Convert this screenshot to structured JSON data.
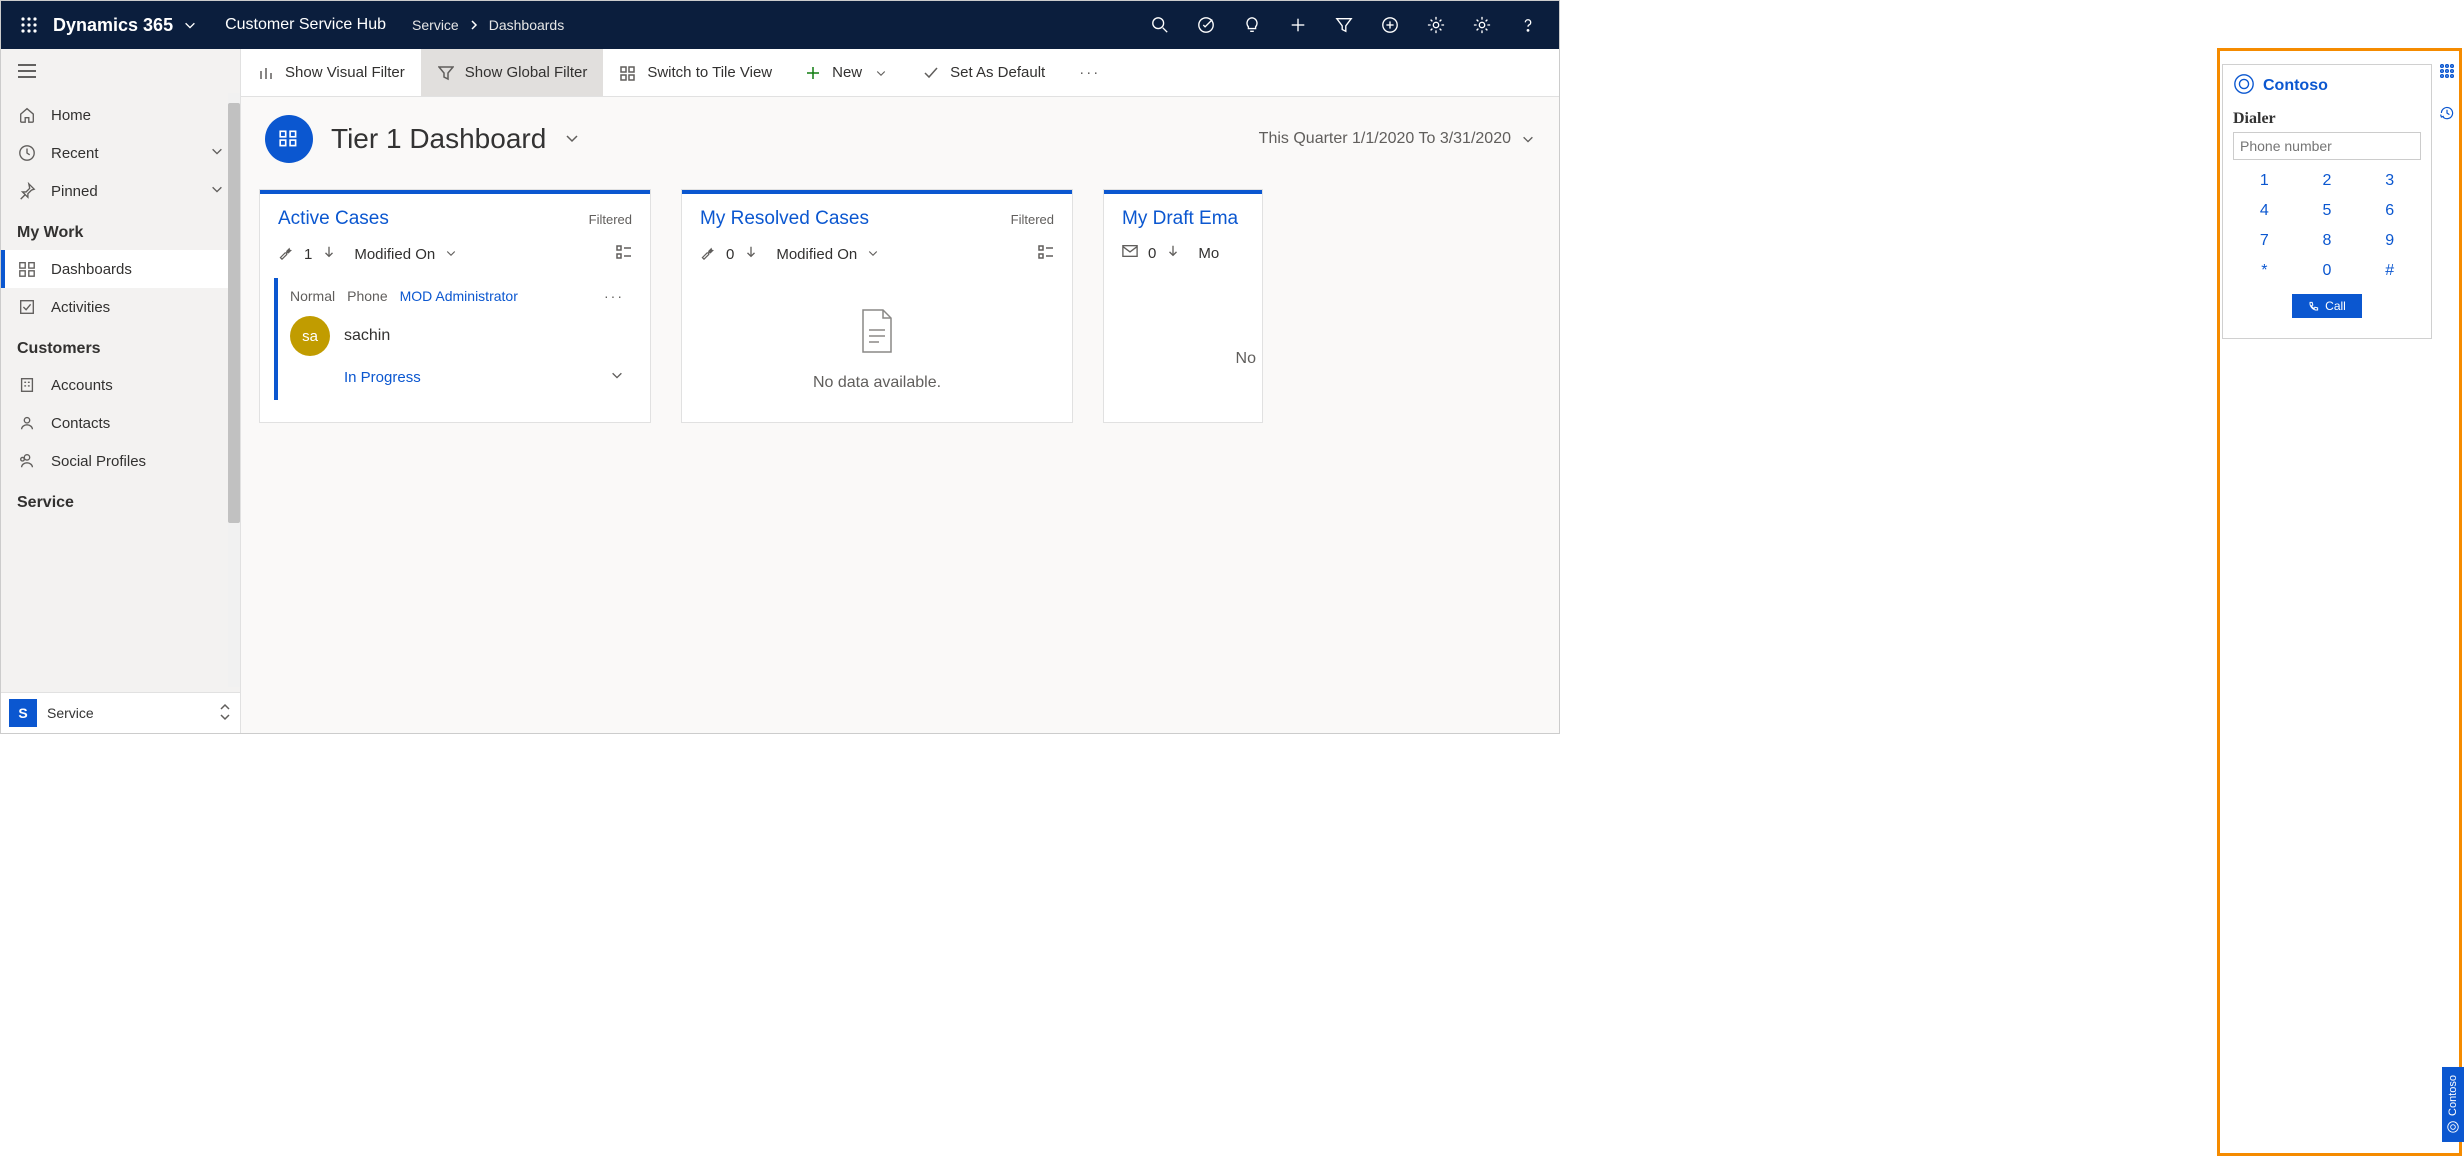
{
  "header": {
    "brand": "Dynamics 365",
    "hub": "Customer Service Hub",
    "crumb1": "Service",
    "crumb2": "Dashboards"
  },
  "nav": {
    "home": "Home",
    "recent": "Recent",
    "pinned": "Pinned",
    "section_work": "My Work",
    "dashboards": "Dashboards",
    "activities": "Activities",
    "section_customers": "Customers",
    "accounts": "Accounts",
    "contacts": "Contacts",
    "social": "Social Profiles",
    "section_service": "Service",
    "footer_initial": "S",
    "footer_label": "Service"
  },
  "cmdbar": {
    "visual": "Show Visual Filter",
    "global": "Show Global Filter",
    "tile": "Switch to Tile View",
    "newlabel": "New",
    "default": "Set As Default"
  },
  "content": {
    "title": "Tier 1 Dashboard",
    "date_range": "This Quarter 1/1/2020 To 3/31/2020"
  },
  "card_active": {
    "title": "Active Cases",
    "filtered": "Filtered",
    "count": "1",
    "sort": "Modified On",
    "item": {
      "priority": "Normal",
      "channel": "Phone",
      "owner": "MOD Administrator",
      "avatar": "sa",
      "name": "sachin",
      "status": "In Progress"
    }
  },
  "card_resolved": {
    "title": "My Resolved Cases",
    "filtered": "Filtered",
    "count": "0",
    "sort": "Modified On",
    "empty": "No data available."
  },
  "card_draft": {
    "title": "My Draft Ema",
    "count": "0",
    "sort": "Mo",
    "empty": "No"
  },
  "contoso": {
    "brand": "Contoso",
    "section": "Dialer",
    "placeholder": "Phone number",
    "keys": [
      [
        "1",
        "2",
        "3"
      ],
      [
        "4",
        "5",
        "6"
      ],
      [
        "7",
        "8",
        "9"
      ],
      [
        "*",
        "0",
        "#"
      ]
    ],
    "call": "Call",
    "tab": "Contoso"
  }
}
